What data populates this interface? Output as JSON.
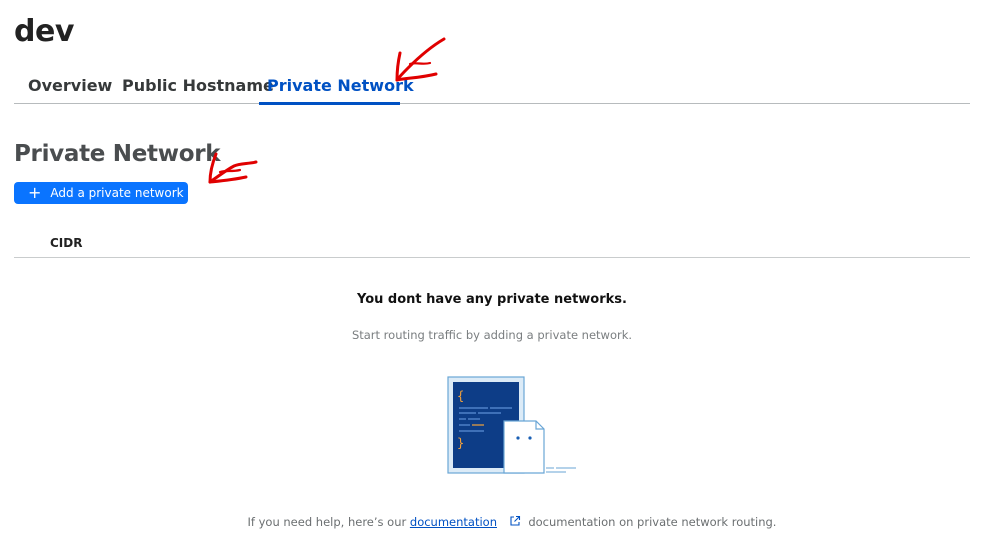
{
  "header": {
    "title": "dev"
  },
  "tabs": [
    {
      "label": "Overview"
    },
    {
      "label": "Public Hostname"
    },
    {
      "label": "Private Network"
    }
  ],
  "section": {
    "title": "Private Network",
    "add_button_label": "Add a private network"
  },
  "table": {
    "columns": [
      "CIDR"
    ]
  },
  "empty_state": {
    "title": "You dont have any private networks.",
    "subtitle": "Start routing traffic by adding a private network."
  },
  "help": {
    "prefix": "If you need help, here’s our",
    "link_text": "documentation",
    "suffix": "documentation on private network routing."
  },
  "colors": {
    "accent": "#0051c3",
    "button": "#0a74ff",
    "annotation": "#e00000"
  }
}
